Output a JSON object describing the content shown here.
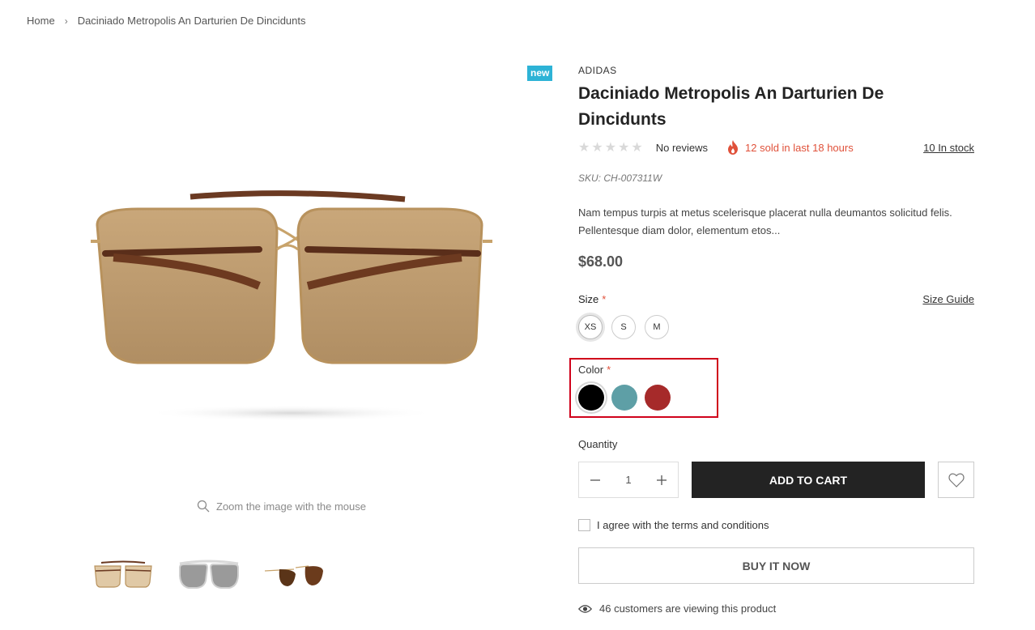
{
  "breadcrumb": {
    "home": "Home",
    "separator": "›",
    "current": "Daciniado Metropolis An Darturien De Dincidunts"
  },
  "gallery": {
    "badge": "new",
    "zoom_hint": "Zoom the image with the mouse",
    "thumbnails": [
      "thumbnail-gold-tan",
      "thumbnail-silver-gray",
      "thumbnail-aviator-brown"
    ]
  },
  "product": {
    "vendor": "ADIDAS",
    "title": "Daciniado Metropolis An Darturien De Dincidunts",
    "rating_stars": "★★★★★",
    "reviews": "No reviews",
    "sold_text": "12 sold in last 18 hours",
    "stock": "10 In stock",
    "sku": "SKU: CH-007311W",
    "description": "Nam tempus turpis at metus scelerisque placerat nulla deumantos solicitud felis. Pellentesque diam dolor, elementum etos...",
    "price": "$68.00"
  },
  "size": {
    "label": "Size",
    "required_mark": "*",
    "guide": "Size Guide",
    "options": [
      "XS",
      "S",
      "M"
    ],
    "selected": "XS"
  },
  "color": {
    "label": "Color",
    "required_mark": "*",
    "options": [
      {
        "name": "black",
        "hex": "#000000"
      },
      {
        "name": "teal",
        "hex": "#5e9fa6"
      },
      {
        "name": "red",
        "hex": "#a62a2a"
      }
    ],
    "selected": "black",
    "highlight_color": "#d0021b"
  },
  "quantity": {
    "label": "Quantity",
    "value": "1"
  },
  "actions": {
    "add_to_cart": "ADD TO CART",
    "terms": "I agree with the terms and conditions",
    "buy_now": "BUY IT NOW"
  },
  "viewers": "46 customers are viewing this product",
  "colors": {
    "accent_badge": "#2db3d6",
    "sold_text": "#e0513a",
    "button_dark": "#232323"
  }
}
